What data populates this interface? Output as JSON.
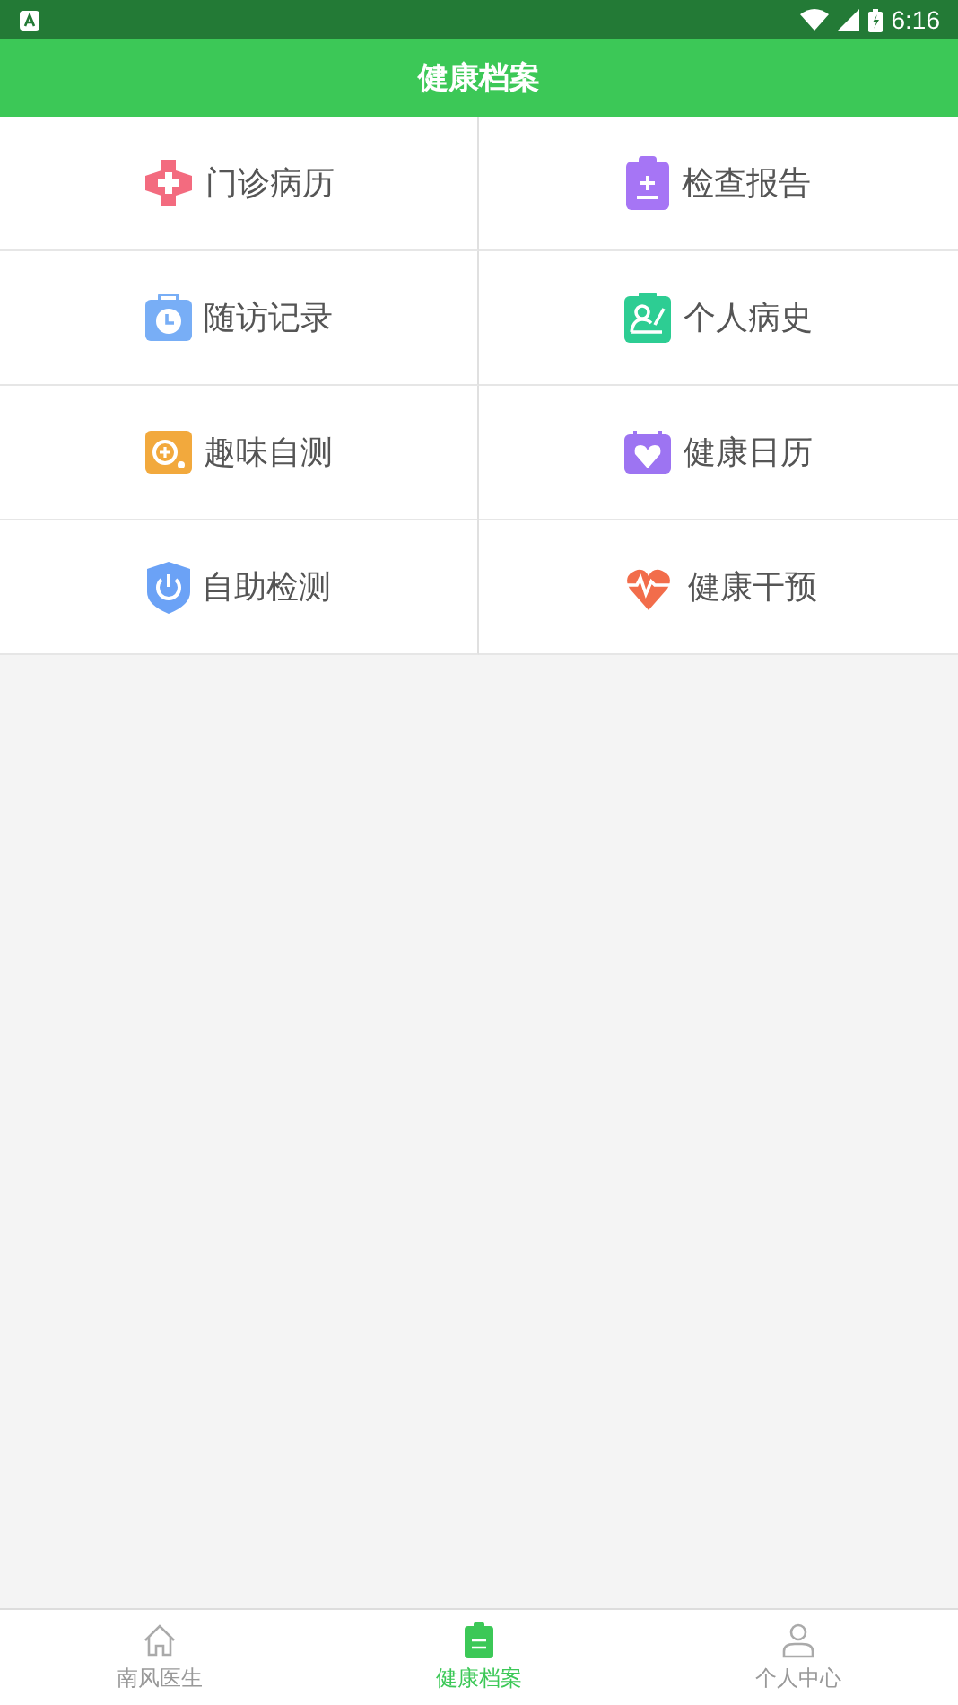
{
  "status_bar": {
    "time": "6:16"
  },
  "header": {
    "title": "健康档案"
  },
  "menu": [
    {
      "label": "门诊病历",
      "kind": "cross"
    },
    {
      "label": "检查报告",
      "kind": "report"
    },
    {
      "label": "随访记录",
      "kind": "clock"
    },
    {
      "label": "个人病史",
      "kind": "person"
    },
    {
      "label": "趣味自测",
      "kind": "test"
    },
    {
      "label": "健康日历",
      "kind": "calendar"
    },
    {
      "label": "自助检测",
      "kind": "shield"
    },
    {
      "label": "健康干预",
      "kind": "heart"
    }
  ],
  "tabs": [
    {
      "label": "南风医生",
      "kind": "home",
      "selected": false
    },
    {
      "label": "健康档案",
      "kind": "file",
      "selected": true
    },
    {
      "label": "个人中心",
      "kind": "user",
      "selected": false
    }
  ]
}
